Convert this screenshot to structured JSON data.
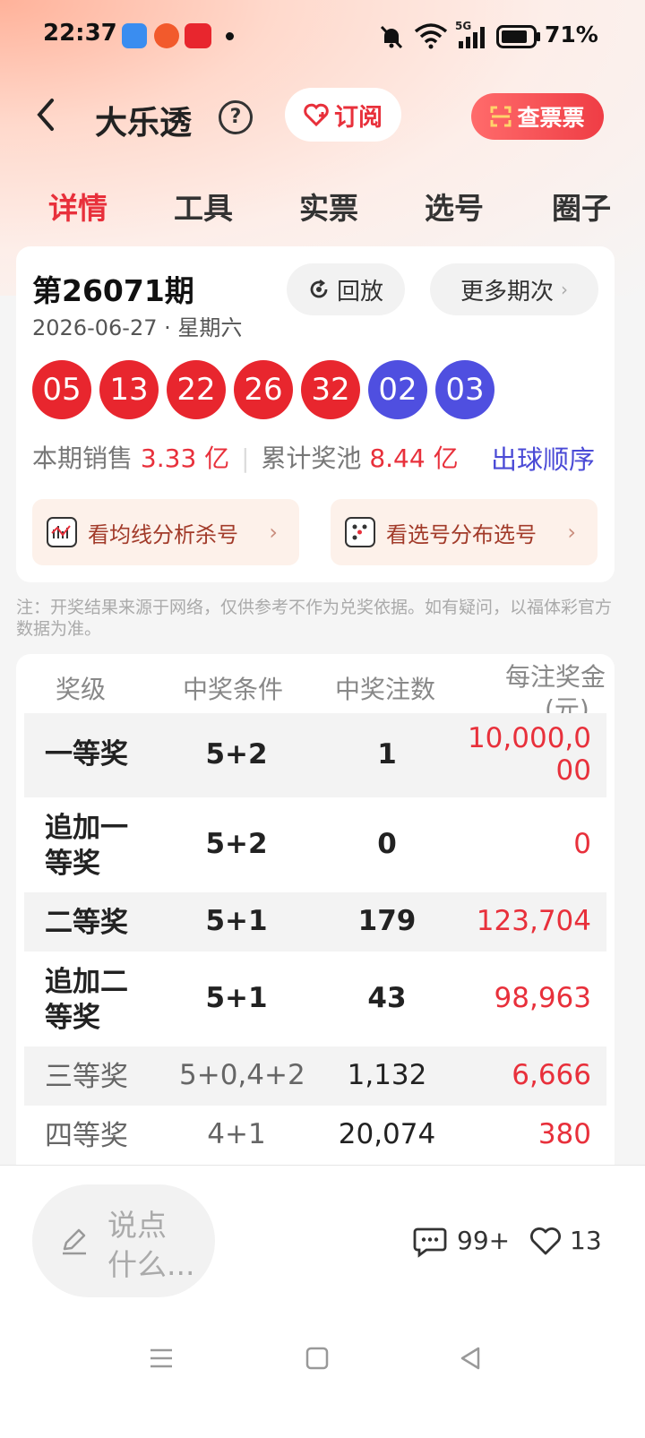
{
  "status_bar": {
    "time": "22:37",
    "network": "5G",
    "battery": "71%"
  },
  "header": {
    "title": "大乐透",
    "subscribe_label": "订阅",
    "check_ticket_label": "查票票"
  },
  "tabs": [
    "详情",
    "工具",
    "实票",
    "选号",
    "圈子"
  ],
  "draw": {
    "issue": "第26071期",
    "date": "2026-06-27 · 星期六",
    "replay_label": "回放",
    "more_label": "更多期次",
    "red_balls": [
      "05",
      "13",
      "22",
      "26",
      "32"
    ],
    "blue_balls": [
      "02",
      "03"
    ],
    "sales_label": "本期销售",
    "sales_value": "3.33 亿",
    "pool_label": "累计奖池",
    "pool_value": "8.44 亿",
    "order_label": "出球顺序",
    "feature_1": "看均线分析杀号",
    "feature_2": "看选号分布选号"
  },
  "note": "注：开奖结果来源于网络，仅供参考不作为兑奖依据。如有疑问，以福体彩官方数据为准。",
  "prize_table": {
    "headers": [
      "奖级",
      "中奖条件",
      "中奖注数",
      "每注奖金",
      "(元)"
    ],
    "rows": [
      {
        "level": "一等奖",
        "cond": "5+2",
        "count": "1",
        "amount_1": "10,000,0",
        "amount_2": "00"
      },
      {
        "level_1": "追加一",
        "level_2": "等奖",
        "cond": "5+2",
        "count": "0",
        "amount": "0"
      },
      {
        "level": "二等奖",
        "cond": "5+1",
        "count": "179",
        "amount": "123,704"
      },
      {
        "level_1": "追加二",
        "level_2": "等奖",
        "cond": "5+1",
        "count": "43",
        "amount": "98,963"
      },
      {
        "level": "三等奖",
        "cond": "5+0,4+2",
        "count": "1,132",
        "amount": "6,666"
      },
      {
        "level": "四等奖",
        "cond": "4+1",
        "count": "20,074",
        "amount": "380"
      }
    ]
  },
  "bottom_bar": {
    "comment_placeholder_1": "说点",
    "comment_placeholder_2": "什么...",
    "comment_count": "99+",
    "like_count": "13"
  }
}
